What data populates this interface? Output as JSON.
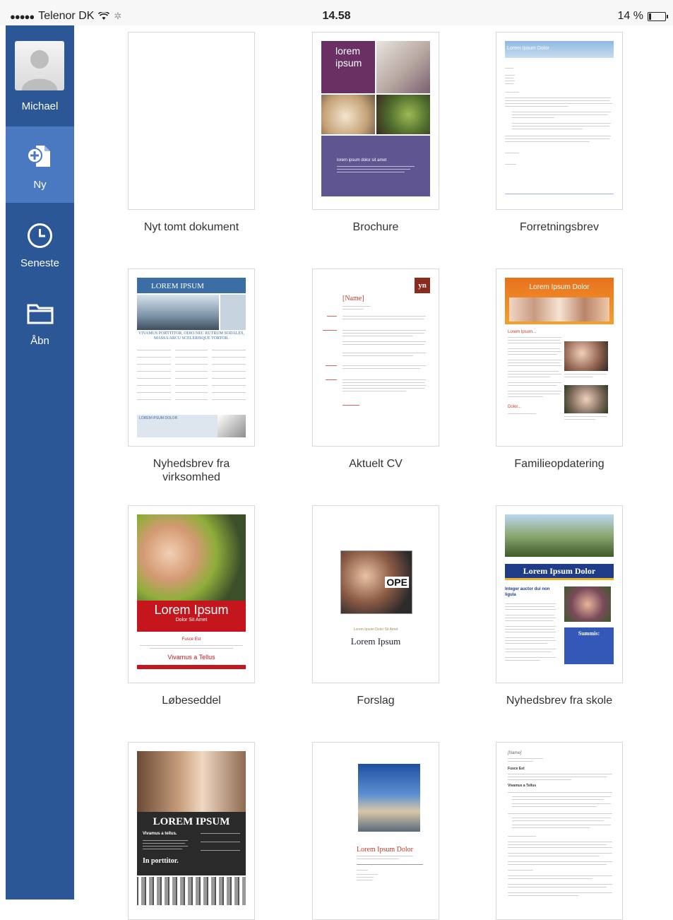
{
  "status": {
    "carrier": "Telenor DK",
    "signal_dots": "●●●●●",
    "time": "14.58",
    "battery": "14 %"
  },
  "sidebar": {
    "user": "Michael",
    "items": [
      {
        "label": "Ny",
        "icon": "new-document-icon"
      },
      {
        "label": "Seneste",
        "icon": "clock-icon"
      },
      {
        "label": "Åbn",
        "icon": "folder-icon"
      }
    ]
  },
  "templates": [
    {
      "label": "Nyt tomt dokument"
    },
    {
      "label": "Brochure",
      "thumb": {
        "title": "lorem ipsum",
        "subtitle": "lorem ipsum dolor sit amet"
      }
    },
    {
      "label": "Forretningsbrev",
      "thumb": {
        "title": "Lorem Ipsum Dolor"
      }
    },
    {
      "label": "Nyhedsbrev fra virksomhed",
      "thumb": {
        "title": "LOREM IPSUM",
        "headline": "VIVAMUS PORTTITOR, ODIO NEC RUTRUM SODALES, MASSA ARCU SCELERISQUE TORTOR.",
        "box": "LOREM IPSUM DOLOR"
      }
    },
    {
      "label": "Aktuelt CV",
      "thumb": {
        "name": "[Name]",
        "initials": "yn"
      }
    },
    {
      "label": "Familieopdatering",
      "thumb": {
        "title": "Lorem Ipsum Dolor",
        "sub": "Lorem Ipsum...",
        "sign": "Dolor..."
      }
    },
    {
      "label": "Løbeseddel",
      "thumb": {
        "title": "Lorem Ipsum",
        "sub": "Dolor Sit Amet",
        "a": "Fusce Est",
        "b": "Vivamus a Tellus"
      }
    },
    {
      "label": "Forslag",
      "thumb": {
        "small": "Lorem Ipsum Dolor Sit Amet",
        "title": "Lorem Ipsum",
        "sign": "OPE"
      }
    },
    {
      "label": "Nyhedsbrev fra skole",
      "thumb": {
        "title": "Lorem Ipsum Dolor",
        "sub": "Integer auctor dui non ligula",
        "box": "Summis:"
      }
    },
    {
      "label": "",
      "thumb": {
        "title": "LOREM IPSUM",
        "sub": "Vivamus a tellus.",
        "foot": "In porttitor."
      }
    },
    {
      "label": "",
      "thumb": {
        "title": "Lorem Ipsum Dolor"
      }
    },
    {
      "label": "",
      "thumb": {
        "name": "[Name]",
        "a": "Fusce Est",
        "b": "Vivamus a Tellus"
      }
    }
  ],
  "colors": {
    "sidebar": "#2b5797",
    "sidebar_active": "#4a79c1",
    "brochure_purple": "#6a2f63",
    "flyer_red": "#c4161c"
  }
}
